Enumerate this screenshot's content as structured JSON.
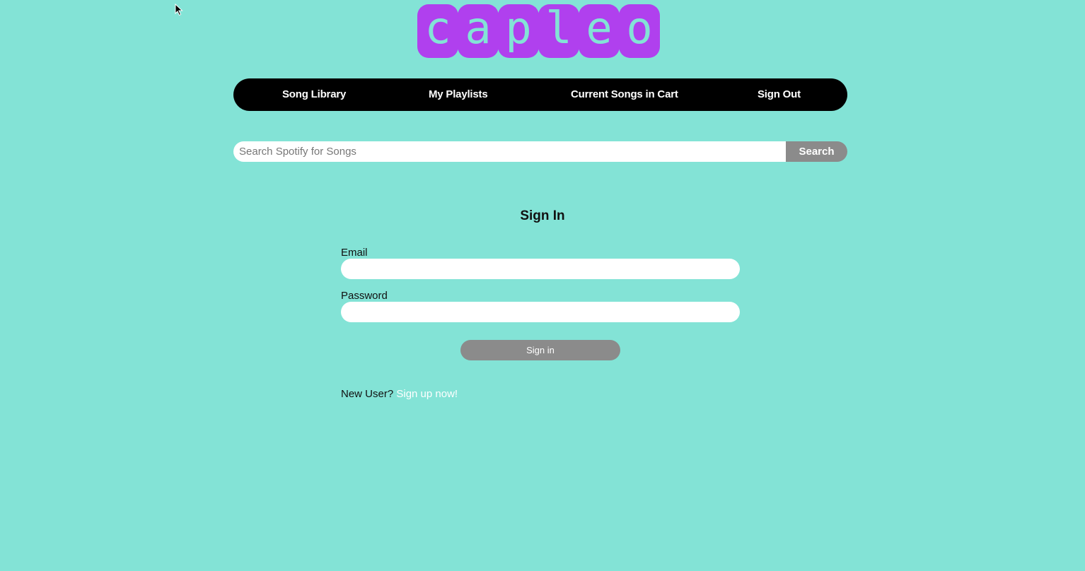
{
  "logo": {
    "letters": [
      "c",
      "a",
      "p",
      "l",
      "e",
      "o"
    ],
    "tile_color": "#b040ee"
  },
  "nav": {
    "items": [
      {
        "label": "Song Library"
      },
      {
        "label": "My Playlists"
      },
      {
        "label": "Current Songs in Cart"
      },
      {
        "label": "Sign Out"
      }
    ]
  },
  "search": {
    "placeholder": "Search Spotify for Songs",
    "value": "",
    "button_label": "Search"
  },
  "signin": {
    "title": "Sign In",
    "email_label": "Email",
    "email_value": "",
    "password_label": "Password",
    "password_value": "",
    "submit_label": "Sign in",
    "new_user_text": "New User?",
    "signup_link_text": "Sign up now!"
  },
  "colors": {
    "background": "#83e3d6",
    "nav_background": "#000000",
    "button_gray": "#8b8b8b",
    "logo_purple": "#b040ee",
    "link_white": "#ffffff"
  }
}
